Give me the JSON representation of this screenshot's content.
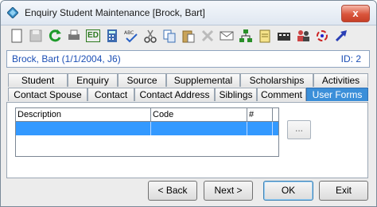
{
  "window": {
    "title": "Enquiry Student Maintenance  [Brock, Bart]",
    "close_glyph": "x"
  },
  "toolbar": {
    "icons": [
      "new-icon",
      "save-icon",
      "refresh-icon",
      "print-icon",
      "edit-ed-icon",
      "calculator-icon",
      "spellcheck-icon",
      "cut-icon",
      "copy-icon",
      "paste-icon",
      "delete-icon",
      "mail-icon",
      "network-icon",
      "notes-icon",
      "film-icon",
      "people-icon",
      "sync-icon",
      "arrow-icon"
    ],
    "ed_label": "ED"
  },
  "record": {
    "name": "Brock, Bart (1/1/2004, J6)",
    "id": "ID: 2"
  },
  "tabs_row1": [
    "Student",
    "Enquiry",
    "Source",
    "Supplemental",
    "Scholarships",
    "Activities"
  ],
  "tabs_row2": [
    "Contact Spouse",
    "Contact",
    "Contact Address",
    "Siblings",
    "Comment",
    "User Forms"
  ],
  "active_tab": "User Forms",
  "grid": {
    "columns": [
      "Description",
      "Code",
      "#"
    ]
  },
  "side_button": "...",
  "buttons": {
    "back": "< Back",
    "next": "Next >",
    "ok": "OK",
    "exit": "Exit"
  },
  "colors": {
    "selection": "#3399ff",
    "accent": "#1c4fb5",
    "active_tab": "#3b8fd9"
  }
}
